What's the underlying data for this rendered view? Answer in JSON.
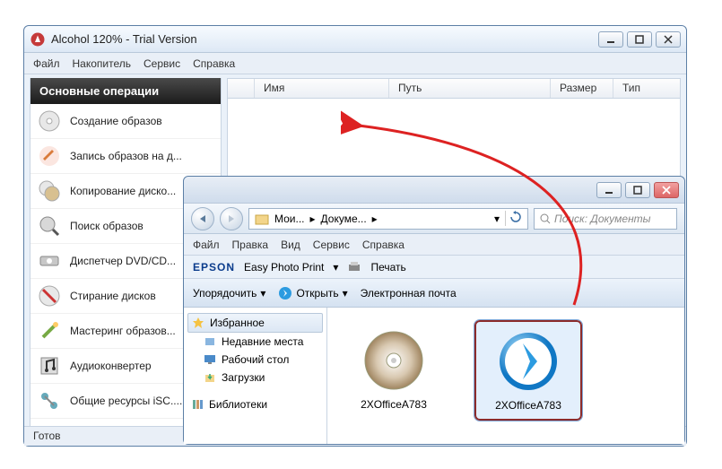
{
  "alcohol": {
    "title": "Alcohol 120% - Trial Version",
    "menu": {
      "file": "Файл",
      "drive": "Накопитель",
      "service": "Сервис",
      "help": "Справка"
    },
    "panel_title": "Основные операции",
    "ops": {
      "0": "Создание образов",
      "1": "Запись образов на д...",
      "2": "Копирование диско...",
      "3": "Поиск образов",
      "4": "Диспетчер DVD/CD...",
      "5": "Стирание дисков",
      "6": "Мастеринг образов...",
      "7": "Аудиоконвертер",
      "8": "Общие ресурсы iSC...."
    },
    "cols": {
      "name": "Имя",
      "path": "Путь",
      "size": "Размер",
      "type": "Тип"
    },
    "status": "Готов"
  },
  "explorer": {
    "menu": {
      "file": "Файл",
      "edit": "Правка",
      "view": "Вид",
      "service": "Сервис",
      "help": "Справка"
    },
    "breadcrumb": {
      "p0": "Мои...",
      "p1": "Докуме..."
    },
    "search_placeholder": "Поиск: Документы",
    "epson": {
      "brand": "EPSON",
      "label": "Easy Photo Print",
      "print": "Печать"
    },
    "toolbar": {
      "organize": "Упорядочить",
      "open": "Открыть",
      "email": "Электронная почта"
    },
    "tree": {
      "fav": "Избранное",
      "recent": "Недавние места",
      "desktop": "Рабочий стол",
      "downloads": "Загрузки",
      "libs": "Библиотеки"
    },
    "files": {
      "f0": "2XOfficeA783",
      "f1": "2XOfficeA783"
    }
  }
}
